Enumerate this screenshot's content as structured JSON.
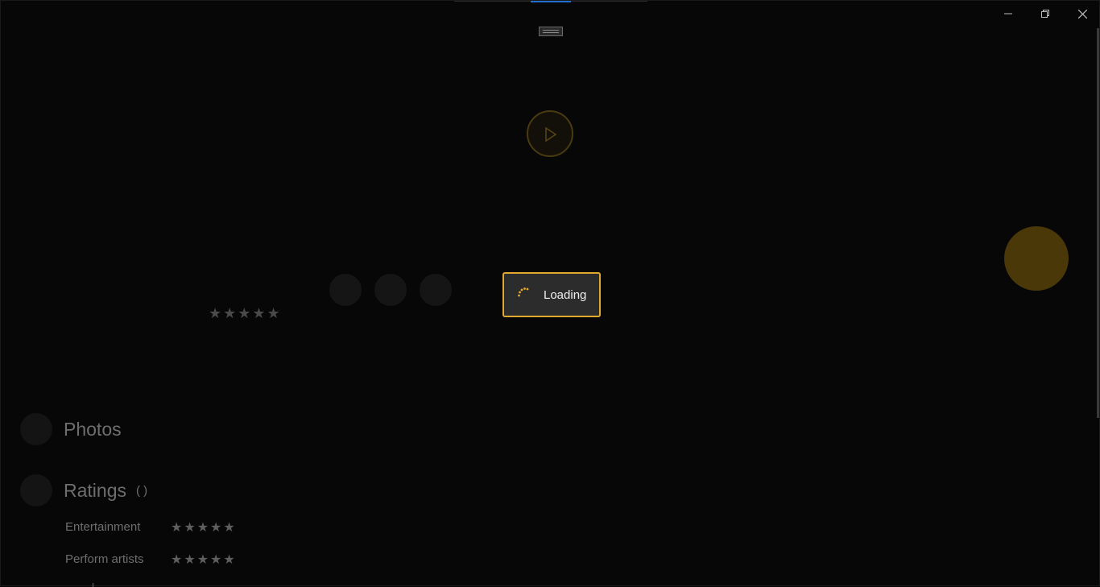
{
  "window": {
    "controls": {
      "minimize_icon": "minimize-icon",
      "restore_icon": "restore-icon",
      "close_icon": "close-icon"
    },
    "accent_color": "#1e6fd0"
  },
  "hero": {
    "play_icon": "play-icon",
    "main_stars": "★★★★★",
    "accent": "#e0a82e"
  },
  "loading": {
    "text": "Loading"
  },
  "sections": {
    "photos": {
      "title": "Photos"
    },
    "ratings": {
      "title": "Ratings",
      "count": "( )",
      "rows": [
        {
          "label": "Entertainment",
          "stars": "★★★★★"
        },
        {
          "label": "Perform artists",
          "stars": "★★★★★"
        }
      ]
    }
  }
}
